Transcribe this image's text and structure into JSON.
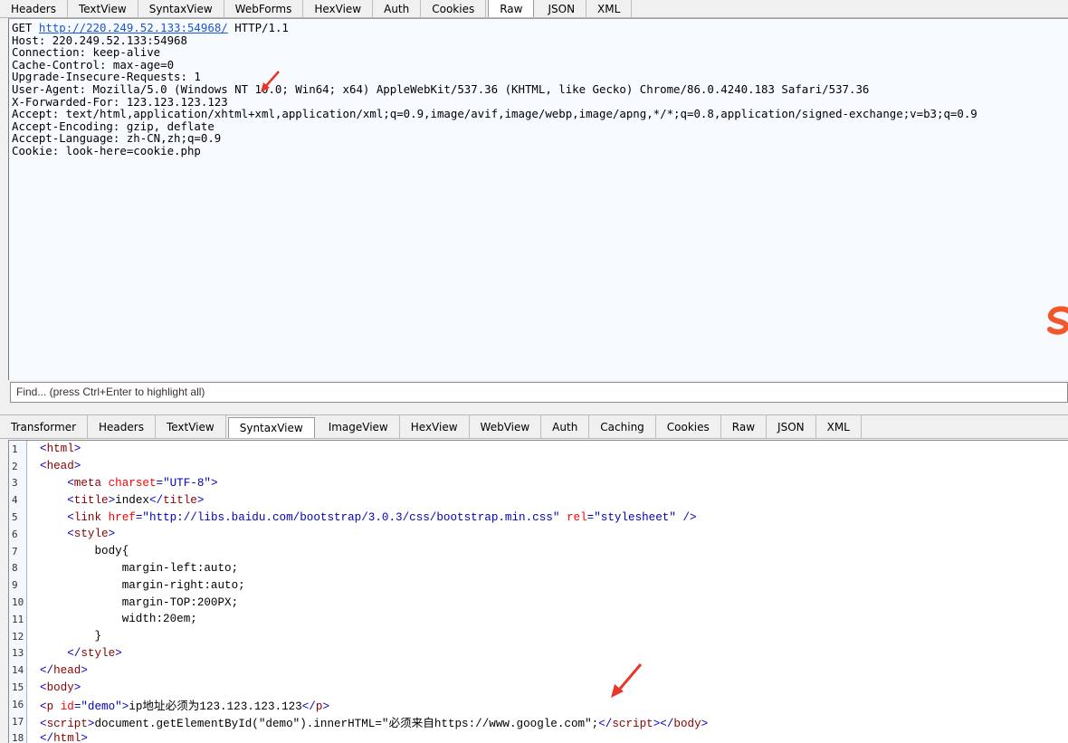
{
  "top_tabs": [
    "Headers",
    "TextView",
    "SyntaxView",
    "WebForms",
    "HexView",
    "Auth",
    "Cookies",
    "Raw",
    "JSON",
    "XML"
  ],
  "top_active_tab": "Raw",
  "request": {
    "method": "GET",
    "url": "http://220.249.52.133:54968/",
    "protocol": "HTTP/1.1",
    "headers": [
      "Host: 220.249.52.133:54968",
      "Connection: keep-alive",
      "Cache-Control: max-age=0",
      "Upgrade-Insecure-Requests: 1",
      "User-Agent: Mozilla/5.0 (Windows NT 10.0; Win64; x64) AppleWebKit/537.36 (KHTML, like Gecko) Chrome/86.0.4240.183 Safari/537.36",
      "X-Forwarded-For: 123.123.123.123",
      "Accept: text/html,application/xhtml+xml,application/xml;q=0.9,image/avif,image/webp,image/apng,*/*;q=0.8,application/signed-exchange;v=b3;q=0.9",
      "Accept-Encoding: gzip, deflate",
      "Accept-Language: zh-CN,zh;q=0.9",
      "Cookie: look-here=cookie.php"
    ]
  },
  "find_placeholder": "Find... (press Ctrl+Enter to highlight all)",
  "bottom_tabs": [
    "Transformer",
    "Headers",
    "TextView",
    "SyntaxView",
    "ImageView",
    "HexView",
    "WebView",
    "Auth",
    "Caching",
    "Cookies",
    "Raw",
    "JSON",
    "XML"
  ],
  "bottom_active_tab": "SyntaxView",
  "code_lines": [
    [
      [
        "punc",
        "<"
      ],
      [
        "tag",
        "html"
      ],
      [
        "punc",
        ">"
      ]
    ],
    [
      [
        "punc",
        "<"
      ],
      [
        "tag",
        "head"
      ],
      [
        "punc",
        ">"
      ]
    ],
    [
      [
        "txt",
        "    "
      ],
      [
        "punc",
        "<"
      ],
      [
        "tag",
        "meta"
      ],
      [
        "txt",
        " "
      ],
      [
        "attr",
        "charset"
      ],
      [
        "punc",
        "="
      ],
      [
        "val",
        "\"UTF-8\""
      ],
      [
        "punc",
        ">"
      ]
    ],
    [
      [
        "txt",
        "    "
      ],
      [
        "punc",
        "<"
      ],
      [
        "tag",
        "title"
      ],
      [
        "punc",
        ">"
      ],
      [
        "txt",
        "index"
      ],
      [
        "punc",
        "</"
      ],
      [
        "tag",
        "title"
      ],
      [
        "punc",
        ">"
      ]
    ],
    [
      [
        "txt",
        "    "
      ],
      [
        "punc",
        "<"
      ],
      [
        "tag",
        "link"
      ],
      [
        "txt",
        " "
      ],
      [
        "attr",
        "href"
      ],
      [
        "punc",
        "="
      ],
      [
        "val",
        "\"http://libs.baidu.com/bootstrap/3.0.3/css/bootstrap.min.css\""
      ],
      [
        "txt",
        " "
      ],
      [
        "attr",
        "rel"
      ],
      [
        "punc",
        "="
      ],
      [
        "val",
        "\"stylesheet\""
      ],
      [
        "txt",
        " "
      ],
      [
        "punc",
        "/>"
      ]
    ],
    [
      [
        "txt",
        "    "
      ],
      [
        "punc",
        "<"
      ],
      [
        "tag",
        "style"
      ],
      [
        "punc",
        ">"
      ]
    ],
    [
      [
        "txt",
        "        body{"
      ]
    ],
    [
      [
        "txt",
        "            margin-left:auto;"
      ]
    ],
    [
      [
        "txt",
        "            margin-right:auto;"
      ]
    ],
    [
      [
        "txt",
        "            margin-TOP:200PX;"
      ]
    ],
    [
      [
        "txt",
        "            width:20em;"
      ]
    ],
    [
      [
        "txt",
        "        }"
      ]
    ],
    [
      [
        "txt",
        "    "
      ],
      [
        "punc",
        "</"
      ],
      [
        "tag",
        "style"
      ],
      [
        "punc",
        ">"
      ]
    ],
    [
      [
        "punc",
        "</"
      ],
      [
        "tag",
        "head"
      ],
      [
        "punc",
        ">"
      ]
    ],
    [
      [
        "punc",
        "<"
      ],
      [
        "tag",
        "body"
      ],
      [
        "punc",
        ">"
      ]
    ],
    [
      [
        "punc",
        "<"
      ],
      [
        "tag",
        "p"
      ],
      [
        "txt",
        " "
      ],
      [
        "attr",
        "id"
      ],
      [
        "punc",
        "="
      ],
      [
        "val",
        "\"demo\""
      ],
      [
        "punc",
        ">"
      ],
      [
        "txt",
        "ip地址必须为123.123.123.123"
      ],
      [
        "punc",
        "</"
      ],
      [
        "tag",
        "p"
      ],
      [
        "punc",
        ">"
      ]
    ],
    [
      [
        "punc",
        "<"
      ],
      [
        "tag",
        "script"
      ],
      [
        "punc",
        ">"
      ],
      [
        "txt",
        "document.getElementById(\"demo\").innerHTML=\"必须来自https://www.google.com\";"
      ],
      [
        "punc",
        "</"
      ],
      [
        "tag",
        "script"
      ],
      [
        "punc",
        "></"
      ],
      [
        "tag",
        "body"
      ],
      [
        "punc",
        ">"
      ]
    ],
    [
      [
        "punc",
        "</"
      ],
      [
        "tag",
        "html"
      ],
      [
        "punc",
        ">"
      ]
    ]
  ],
  "colors": {
    "arrow": "#e8362a",
    "url_link": "#1a55d6",
    "tag": "#880000",
    "attr": "#ff0000",
    "value": "#0000c0",
    "logo": "#f2562b"
  },
  "icons": [
    "red-arrow-icon",
    "sogou-logo-icon"
  ]
}
